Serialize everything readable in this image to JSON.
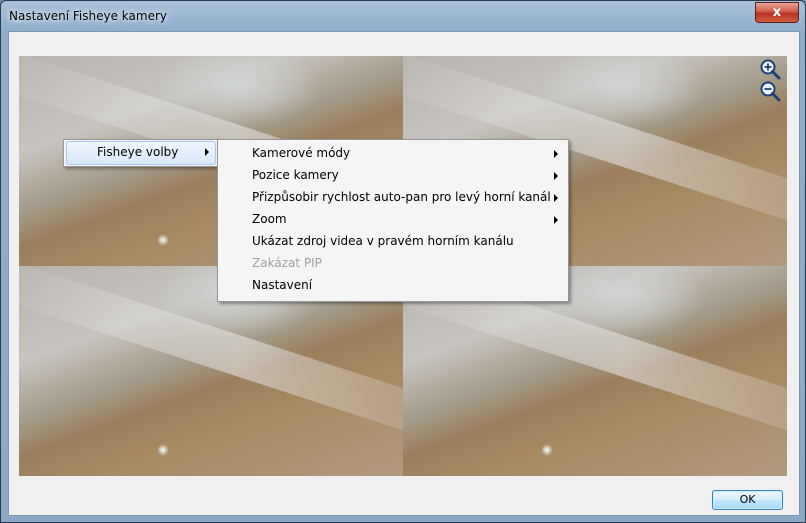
{
  "window": {
    "title": "Nastavení Fisheye kamery",
    "close_glyph": "x"
  },
  "icons": {
    "zoom_in": "zoom-in-icon",
    "zoom_out": "zoom-out-icon"
  },
  "context_menu": {
    "root_item": "Fisheye volby",
    "submenu": [
      {
        "label": "Kamerové módy",
        "has_submenu": true,
        "enabled": true
      },
      {
        "label": "Pozice kamery",
        "has_submenu": true,
        "enabled": true
      },
      {
        "label": "Přizpůsobir rychlost auto-pan pro levý horní kanál",
        "has_submenu": true,
        "enabled": true
      },
      {
        "label": "Zoom",
        "has_submenu": true,
        "enabled": true
      },
      {
        "label": "Ukázat zdroj videa v pravém horním kanálu",
        "has_submenu": false,
        "enabled": true
      },
      {
        "label": "Zakázat PIP",
        "has_submenu": false,
        "enabled": false
      },
      {
        "label": "Nastavení",
        "has_submenu": false,
        "enabled": true
      }
    ]
  },
  "buttons": {
    "ok_label": "OK"
  },
  "colors": {
    "accent": "#3c7fb1",
    "close_red": "#c7442e",
    "disabled_text": "#a0a0a0"
  }
}
